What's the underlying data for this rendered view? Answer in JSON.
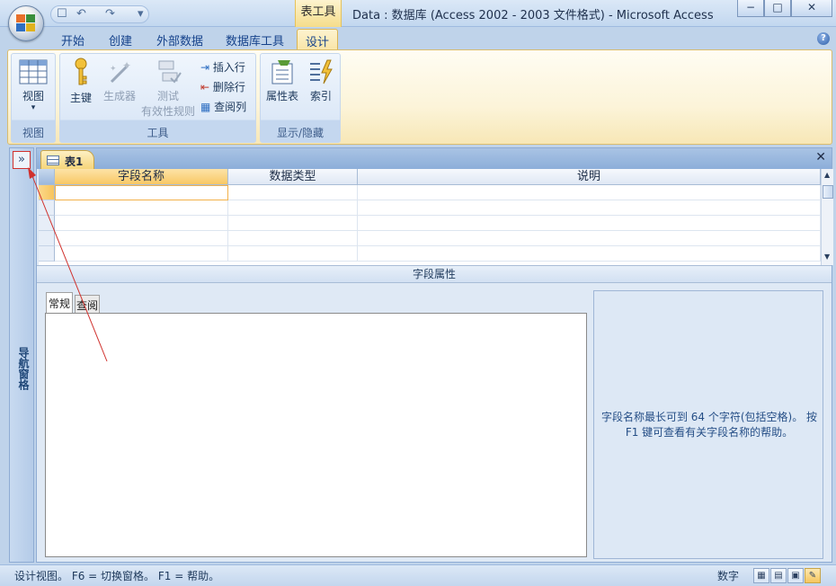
{
  "titlebar": {
    "qat_save": "☐",
    "qat_undo": "↶",
    "qat_redo": "↷",
    "qat_more": "▾",
    "context_tab": "表工具",
    "title": "Data : 数据库 (Access 2002 - 2003 文件格式) - Microsoft Access",
    "min_label": "−",
    "max_label": "□",
    "close_label": "✕"
  },
  "tabs": {
    "home": "开始",
    "create": "创建",
    "external": "外部数据",
    "dbtools": "数据库工具",
    "design": "设计",
    "help": "?"
  },
  "ribbon": {
    "view_label": "视图",
    "view_arrow": "▾",
    "view_group": "视图",
    "primary_key": "主键",
    "builder": "生成器",
    "test_line1": "测试",
    "test_line2": "有效性规则",
    "insert_row": "插入行",
    "delete_row": "删除行",
    "lookup_column": "查阅列",
    "tools_group": "工具",
    "property_sheet": "属性表",
    "indexes": "索引",
    "show_hide_group": "显示/隐藏"
  },
  "nav": {
    "toggle": "»",
    "label": "导航窗格"
  },
  "document": {
    "tab_label": "表1",
    "close": "✕",
    "columns": [
      "字段名称",
      "数据类型",
      "说明"
    ],
    "field_properties": "字段属性",
    "prop_tabs": [
      "常规",
      "查阅"
    ],
    "help_text": "字段名称最长可到 64 个字符(包括空格)。 按 F1 键可查看有关字段名称的帮助。"
  },
  "status": {
    "text": "设计视图。   F6 = 切换窗格。   F1 = 帮助。",
    "mode": "数字",
    "view_icons": [
      "▦",
      "▤",
      "▣",
      "✎"
    ]
  },
  "colors": {
    "accent": "#f6d57a",
    "frame": "#bfd3ea",
    "annotation": "#d0312d"
  }
}
